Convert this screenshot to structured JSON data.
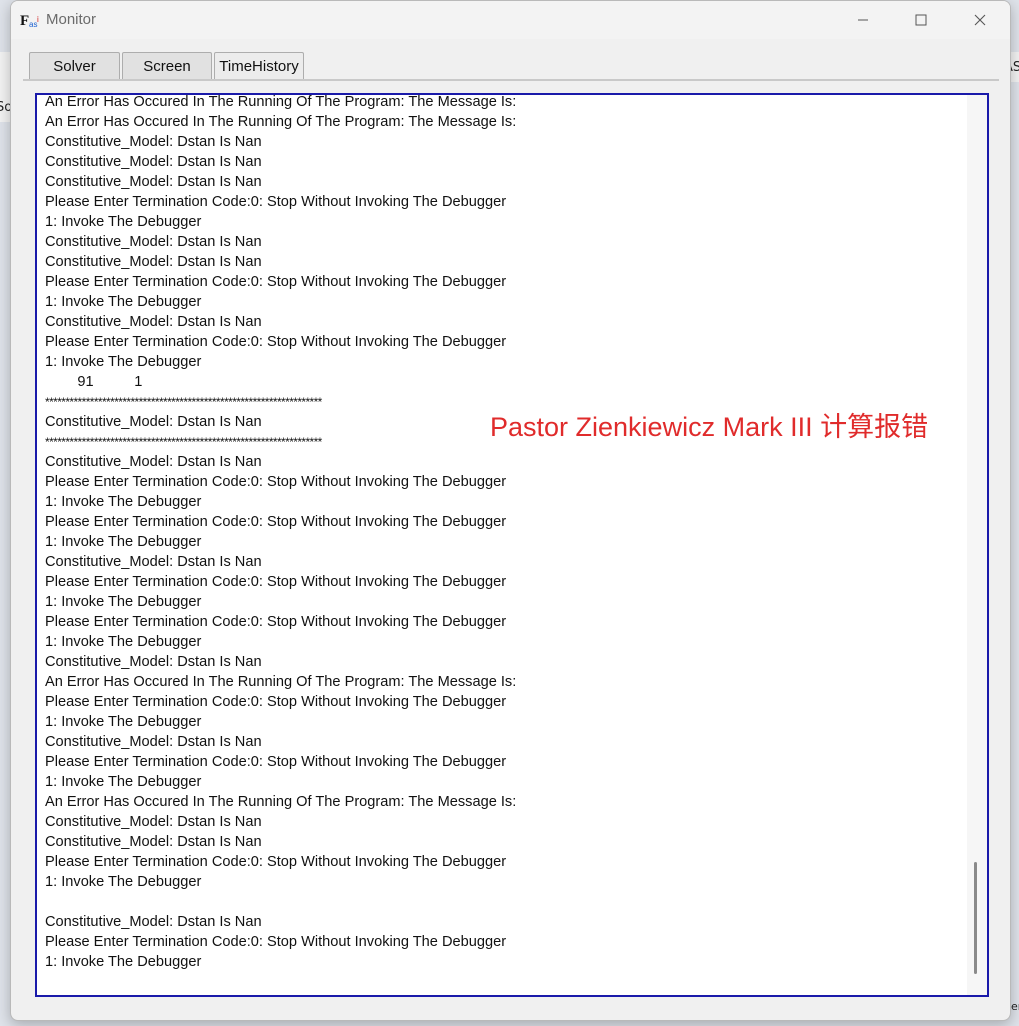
{
  "window": {
    "title": "Monitor"
  },
  "controls": {
    "minimize": "minimize",
    "maximize": "maximize",
    "close": "close"
  },
  "tabs": [
    {
      "label": "Solver"
    },
    {
      "label": "Screen"
    },
    {
      "label": "TimeHistory"
    }
  ],
  "background_fragments": {
    "left": "So",
    "right": "AS",
    "bottom_right": "er"
  },
  "console": {
    "lines": [
      "An Error Has Occured In The Running Of The Program: The Message Is:",
      "An Error Has Occured In The Running Of The Program: The Message Is:",
      "Constitutive_Model: Dstan Is Nan",
      "Constitutive_Model: Dstan Is Nan",
      "Constitutive_Model: Dstan Is Nan",
      "Please Enter Termination Code:0: Stop Without Invoking The Debugger",
      "1: Invoke The Debugger",
      "Constitutive_Model: Dstan Is Nan",
      "Constitutive_Model: Dstan Is Nan",
      "Please Enter Termination Code:0: Stop Without Invoking The Debugger",
      "1: Invoke The Debugger",
      "Constitutive_Model: Dstan Is Nan",
      "Please Enter Termination Code:0: Stop Without Invoking The Debugger",
      "1: Invoke The Debugger",
      "        91          1",
      "********************************************************************",
      "Constitutive_Model: Dstan Is Nan",
      "********************************************************************",
      "Constitutive_Model: Dstan Is Nan",
      "Please Enter Termination Code:0: Stop Without Invoking The Debugger",
      "1: Invoke The Debugger",
      "Please Enter Termination Code:0: Stop Without Invoking The Debugger",
      "1: Invoke The Debugger",
      "Constitutive_Model: Dstan Is Nan",
      "Please Enter Termination Code:0: Stop Without Invoking The Debugger",
      "1: Invoke The Debugger",
      "Please Enter Termination Code:0: Stop Without Invoking The Debugger",
      "1: Invoke The Debugger",
      "Constitutive_Model: Dstan Is Nan",
      "An Error Has Occured In The Running Of The Program: The Message Is:",
      "Please Enter Termination Code:0: Stop Without Invoking The Debugger",
      "1: Invoke The Debugger",
      "Constitutive_Model: Dstan Is Nan",
      "Please Enter Termination Code:0: Stop Without Invoking The Debugger",
      "1: Invoke The Debugger",
      "An Error Has Occured In The Running Of The Program: The Message Is:",
      "Constitutive_Model: Dstan Is Nan",
      "Constitutive_Model: Dstan Is Nan",
      "Please Enter Termination Code:0: Stop Without Invoking The Debugger",
      "1: Invoke The Debugger",
      "",
      "Constitutive_Model: Dstan Is Nan",
      "Please Enter Termination Code:0: Stop Without Invoking The Debugger",
      "1: Invoke The Debugger"
    ]
  },
  "annotation": {
    "text": "Pastor Zienkiewicz Mark III 计算报错",
    "color": "#e02b2b"
  },
  "colors": {
    "console_border": "#1a1aaa",
    "tab_background": "#e1e1e1"
  }
}
